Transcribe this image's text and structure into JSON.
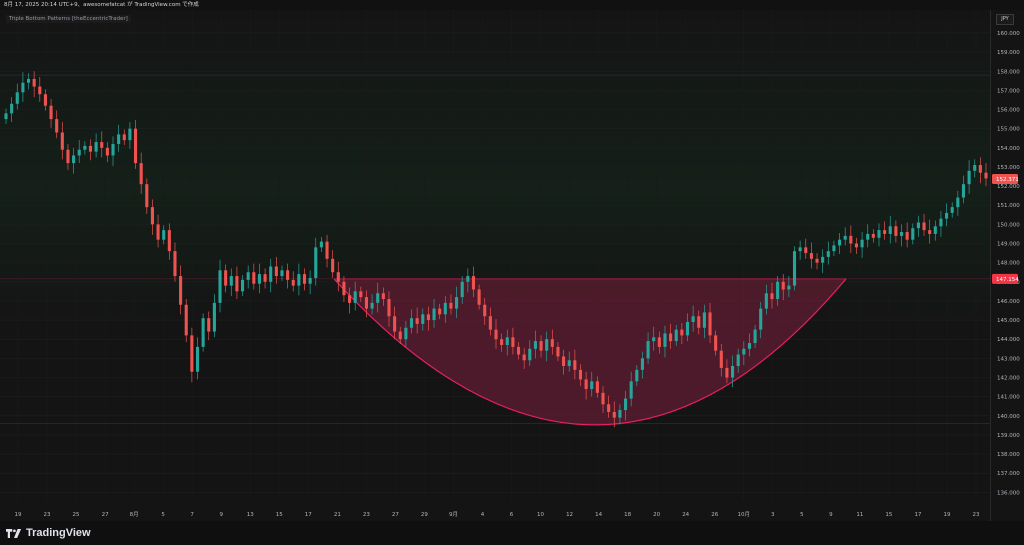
{
  "header": {
    "watermark": "8月 17, 2025 20:14 UTC+9、awesomefatcat が TradingView.com で作成"
  },
  "indicator": {
    "label": "Triple Bottom Patterns [theEccentricTrader]"
  },
  "currency": "JPY",
  "brand": {
    "name": "TradingView"
  },
  "colors": {
    "up": "#26a69a",
    "down": "#ef5350",
    "background": "#141414",
    "pattern_fill": "#7a1f3d",
    "pattern_stroke": "#e91e63",
    "last_price_bg": "#ef5350",
    "neckline_bg": "#f23645"
  },
  "chart_data": {
    "type": "candlestick",
    "ylim": [
      135.6,
      161.2
    ],
    "yticks": [
      136,
      137,
      138,
      139,
      140,
      141,
      142,
      143,
      144,
      145,
      146,
      147,
      148,
      149,
      150,
      151,
      152,
      153,
      154,
      155,
      156,
      157,
      158,
      159,
      160
    ],
    "xticks": [
      "19",
      "23",
      "25",
      "27",
      "8月",
      "5",
      "7",
      "9",
      "13",
      "15",
      "17",
      "21",
      "23",
      "27",
      "29",
      "9月",
      "4",
      "6",
      "10",
      "12",
      "14",
      "18",
      "20",
      "24",
      "26",
      "10月",
      "3",
      "5",
      "9",
      "11",
      "15",
      "17",
      "19",
      "23"
    ],
    "close_path": [
      155.8,
      156.3,
      156.9,
      157.4,
      157.6,
      157.2,
      156.8,
      156.2,
      155.5,
      154.8,
      153.9,
      153.2,
      153.6,
      153.9,
      154.1,
      153.8,
      154.3,
      154.0,
      153.6,
      154.2,
      154.7,
      154.4,
      155.0,
      153.2,
      152.1,
      150.9,
      150.0,
      149.2,
      149.7,
      148.6,
      147.3,
      145.8,
      144.2,
      142.3,
      143.6,
      145.1,
      144.4,
      145.9,
      147.6,
      146.8,
      147.3,
      146.5,
      147.1,
      147.5,
      146.9,
      147.4,
      147.0,
      147.8,
      147.3,
      147.6,
      147.1,
      146.8,
      147.4,
      146.9,
      147.2,
      148.8,
      149.1,
      148.2,
      147.5,
      147.0,
      146.3,
      145.9,
      146.5,
      146.2,
      145.6,
      145.9,
      146.4,
      146.1,
      145.2,
      144.4,
      144.0,
      144.6,
      145.1,
      144.8,
      145.3,
      145.0,
      145.6,
      145.3,
      145.9,
      145.6,
      146.2,
      147.0,
      147.3,
      146.6,
      145.8,
      145.2,
      144.5,
      144.0,
      143.7,
      144.1,
      143.6,
      143.2,
      142.9,
      143.5,
      143.9,
      143.4,
      144.0,
      143.6,
      143.1,
      142.6,
      142.9,
      142.4,
      141.9,
      141.4,
      141.8,
      141.2,
      140.6,
      140.2,
      139.9,
      140.3,
      140.9,
      141.8,
      142.4,
      143.0,
      143.9,
      144.1,
      143.6,
      144.3,
      143.9,
      144.5,
      144.2,
      144.9,
      145.2,
      144.6,
      145.4,
      144.2,
      143.4,
      142.5,
      142.0,
      142.6,
      143.2,
      143.5,
      143.8,
      144.5,
      145.6,
      146.4,
      146.1,
      147.0,
      146.6,
      146.8,
      148.6,
      148.8,
      148.5,
      148.2,
      148.0,
      148.3,
      148.6,
      148.9,
      149.2,
      149.4,
      149.0,
      148.8,
      149.2,
      149.5,
      149.3,
      149.7,
      149.5,
      149.9,
      149.4,
      149.6,
      149.2,
      149.8,
      150.1,
      149.7,
      149.5,
      149.9,
      150.3,
      150.6,
      150.9,
      151.4,
      152.1,
      152.8,
      153.1,
      152.7,
      152.4
    ],
    "pattern": {
      "name": "Triple Bottom",
      "neckline": 147.154,
      "bottom": 139.6,
      "start_date": "8/20",
      "end_date": "10/9"
    },
    "price_labels": [
      {
        "value": 152.371,
        "label": "152.371"
      },
      {
        "value": 147.154,
        "label": "147.154"
      }
    ]
  }
}
